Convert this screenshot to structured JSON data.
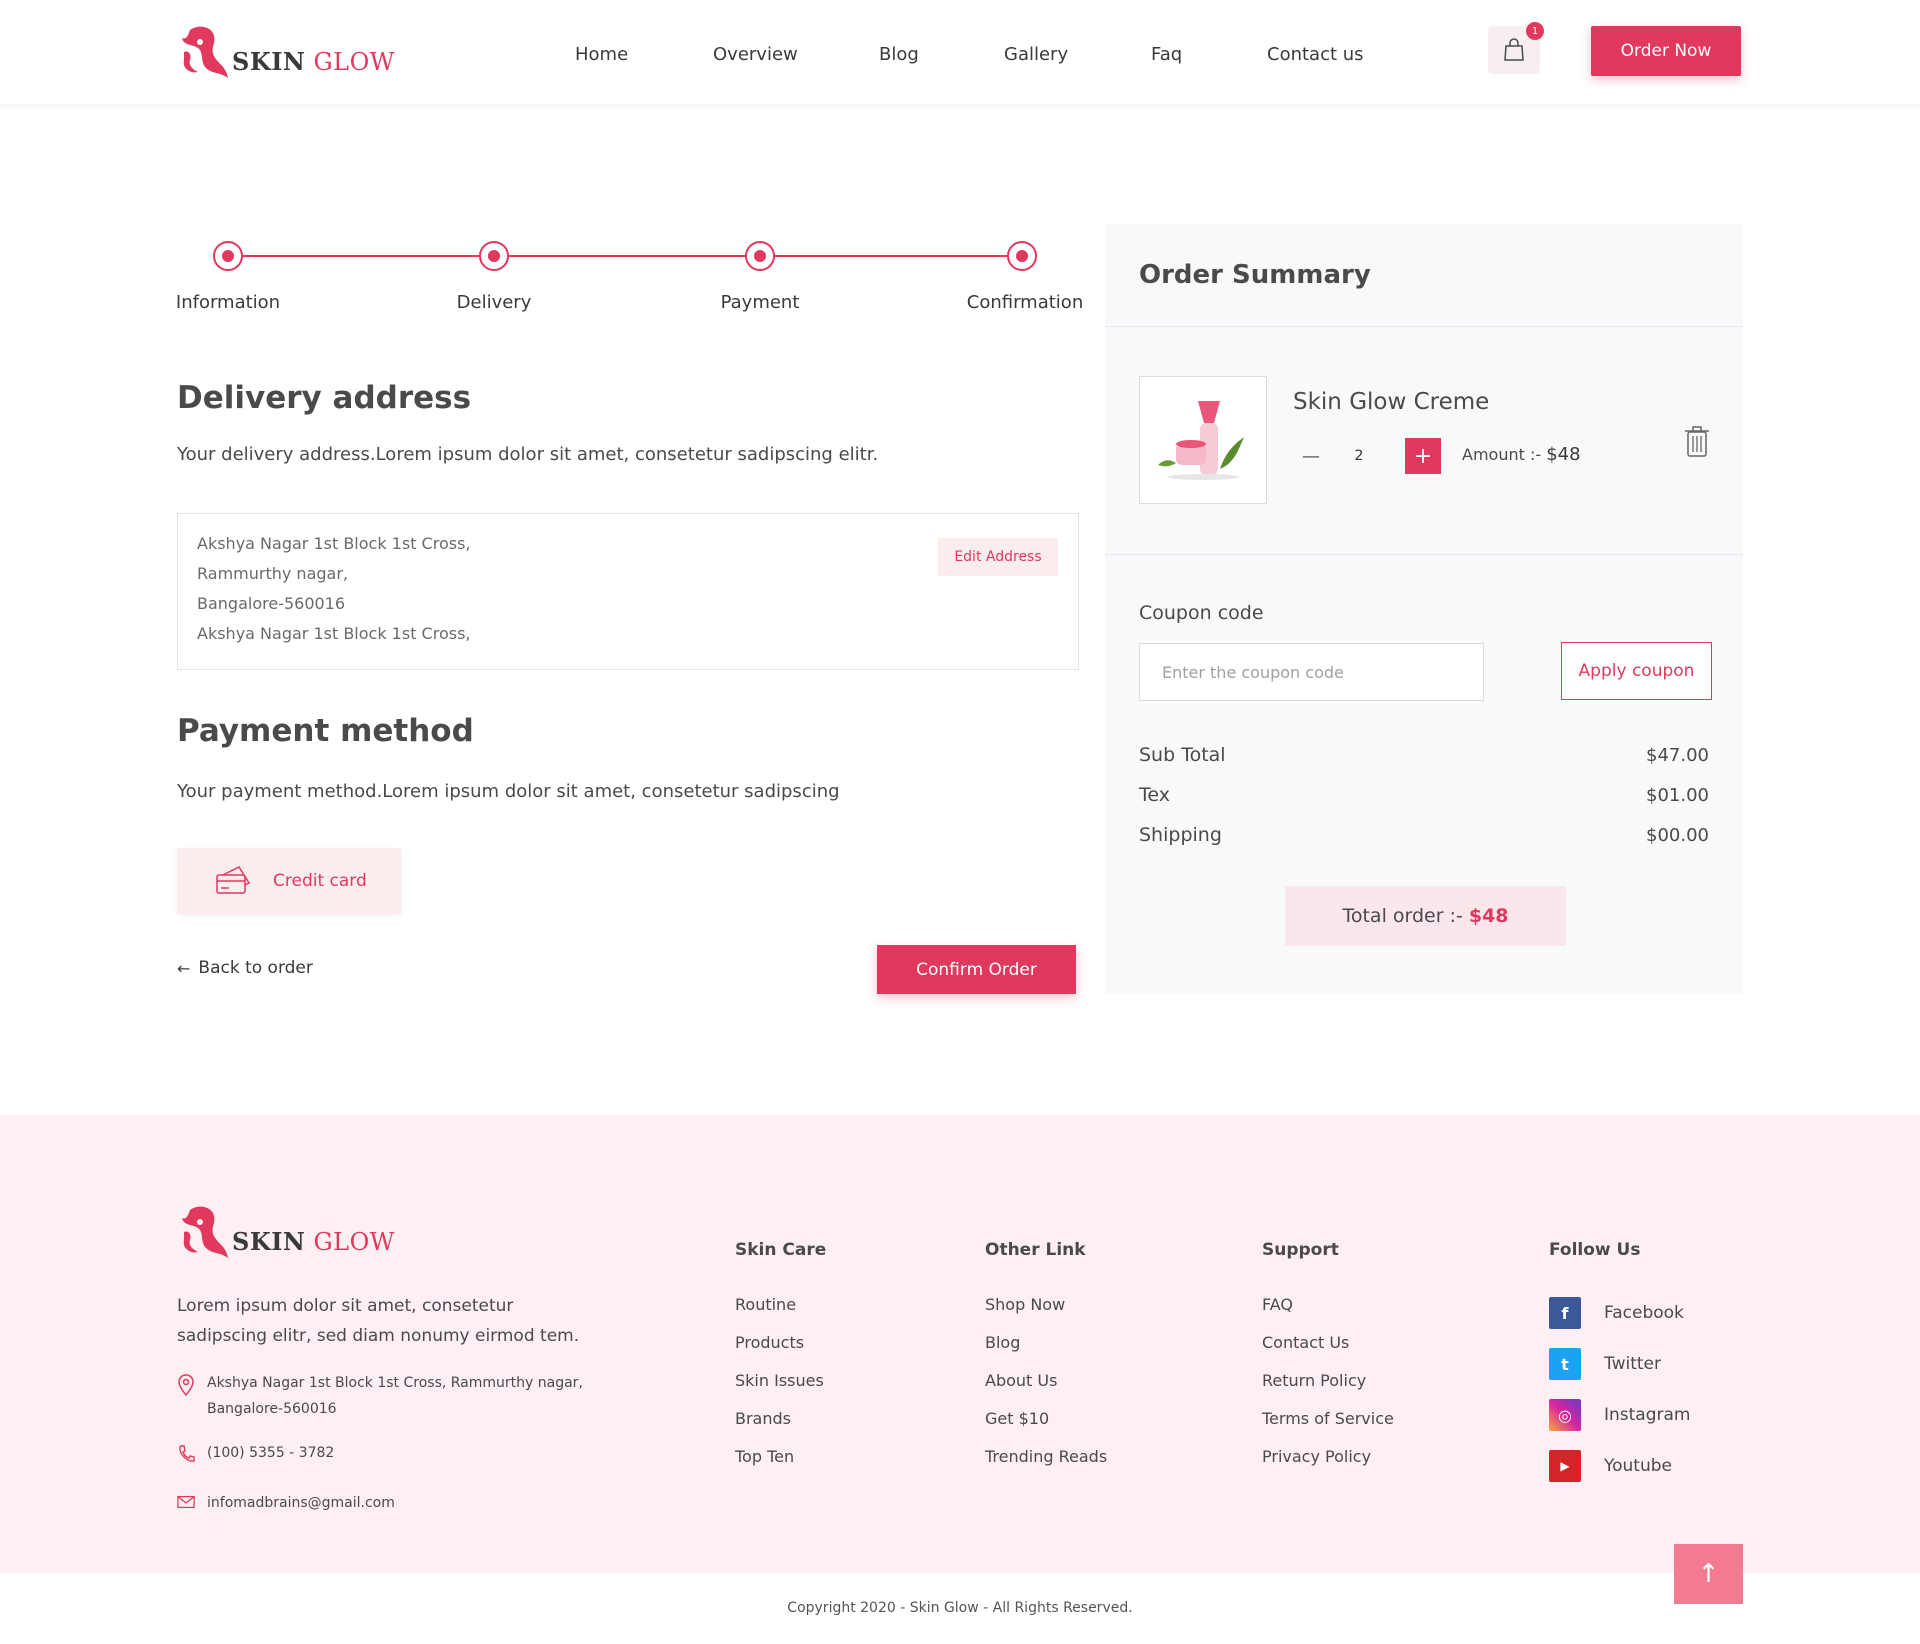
{
  "brand": {
    "skin": "SKIN",
    "glow": "GLOW"
  },
  "nav": [
    "Home",
    "Overview",
    "Blog",
    "Gallery",
    "Faq",
    "Contact us"
  ],
  "cart": {
    "count": "1"
  },
  "order_now_label": "Order Now",
  "steps": [
    "Information",
    "Delivery",
    "Payment",
    "Confirmation"
  ],
  "delivery": {
    "title": "Delivery address",
    "description": "Your delivery address.Lorem ipsum dolor sit amet, consetetur sadipscing elitr.",
    "address_lines": [
      "Akshya Nagar 1st Block 1st Cross,",
      "Rammurthy nagar,",
      "Bangalore-560016",
      "Akshya Nagar 1st Block 1st Cross,"
    ],
    "edit_label": "Edit Address"
  },
  "payment": {
    "title": "Payment method",
    "description": "Your payment method.Lorem ipsum dolor sit amet, consetetur sadipscing",
    "credit_card_label": "Credit card"
  },
  "back_label": "Back to order",
  "confirm_label": "Confirm Order",
  "summary": {
    "title": "Order Summary",
    "product_name": "Skin Glow Creme",
    "qty_minus": "—",
    "qty": "2",
    "qty_plus": "+",
    "amount_label": "Amount :- ",
    "amount_value": "$48",
    "coupon_label": "Coupon code",
    "coupon_placeholder": "Enter the coupon code",
    "apply_label": "Apply coupon",
    "rows": [
      {
        "label": "Sub Total",
        "value": "$47.00"
      },
      {
        "label": "Tex",
        "value": "$01.00"
      },
      {
        "label": "Shipping",
        "value": "$00.00"
      }
    ],
    "total_label": "Total order :- ",
    "total_value": "$48"
  },
  "footer": {
    "about_line1": "Lorem ipsum dolor sit amet, consetetur",
    "about_line2": "sadipscing elitr, sed diam nonumy eirmod tem.",
    "address_line1": "Akshya Nagar 1st Block 1st Cross, Rammurthy nagar,",
    "address_line2": "Bangalore-560016",
    "phone": "(100) 5355 - 3782",
    "email": "infomadbrains@gmail.com",
    "columns": [
      {
        "title": "Skin Care",
        "links": [
          "Routine",
          "Products",
          "Skin Issues",
          "Brands",
          "Top Ten"
        ]
      },
      {
        "title": "Other Link",
        "links": [
          "Shop Now",
          "Blog",
          "About Us",
          "Get $10",
          "Trending Reads"
        ]
      },
      {
        "title": "Support",
        "links": [
          "FAQ",
          "Contact Us",
          "Return Policy",
          "Terms of Service",
          "Privacy Policy"
        ]
      }
    ],
    "follow_title": "Follow Us",
    "social": [
      {
        "label": "Facebook",
        "icon": "facebook-icon",
        "glyph": "f",
        "color": "#3b5998"
      },
      {
        "label": "Twitter",
        "icon": "twitter-icon",
        "glyph": "t",
        "color": "#1da1f2"
      },
      {
        "label": "Instagram",
        "icon": "instagram-icon",
        "glyph": "◎",
        "color": "#d6249f"
      },
      {
        "label": "Youtube",
        "icon": "youtube-icon",
        "glyph": "▶",
        "color": "#d42428"
      }
    ],
    "copyright": "Copyright 2020 - Skin Glow - All Rights Reserved."
  },
  "colors": {
    "accent": "#e0395d",
    "accent_soft": "#fbecee",
    "footer_bg": "#fdeff2"
  }
}
